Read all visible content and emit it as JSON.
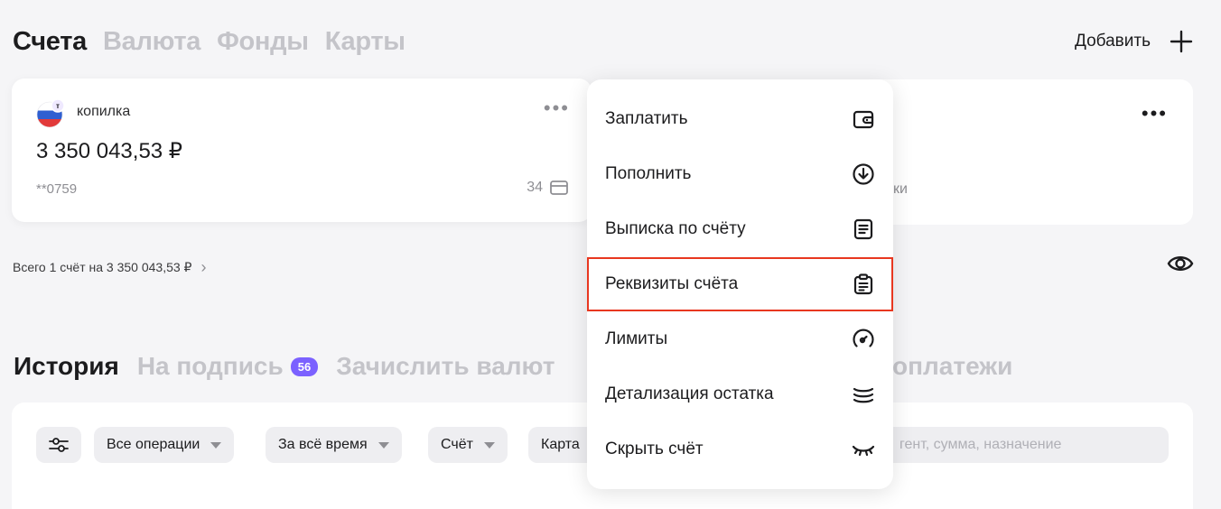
{
  "accounts_tabs": [
    "Счета",
    "Валюта",
    "Фонды",
    "Карты"
  ],
  "add_button": {
    "label": "Добавить",
    "icon": "plus-icon"
  },
  "card1": {
    "name": "копилка",
    "bank_badge": "т",
    "amount": "3 350 043,53 ₽",
    "number": "**0759",
    "cards_count": "34"
  },
  "card2": {
    "fragment": "ки"
  },
  "total": {
    "text": "Всего 1 счёт на 3 350 043,53 ₽"
  },
  "history_tabs": {
    "history": "История",
    "to_sign": "На подпись",
    "to_sign_badge": "56",
    "credit_currency": "Зачислить валют",
    "payments_fragment": "оплатежи"
  },
  "filters": {
    "all_ops": "Все операции",
    "period": "За всё время",
    "account": "Счёт",
    "card": "Карта",
    "search_placeholder": "гент, сумма, назначение"
  },
  "context_menu": {
    "items": [
      {
        "label": "Заплатить",
        "icon": "wallet-icon"
      },
      {
        "label": "Пополнить",
        "icon": "download-circle-icon"
      },
      {
        "label": "Выписка по счёту",
        "icon": "statement-icon"
      },
      {
        "label": "Реквизиты счёта",
        "icon": "clipboard-icon"
      },
      {
        "label": "Лимиты",
        "icon": "gauge-icon"
      },
      {
        "label": "Детализация остатка",
        "icon": "stack-icon"
      },
      {
        "label": "Скрыть счёт",
        "icon": "eye-closed-icon"
      }
    ],
    "highlight_color": "#e8371f"
  },
  "colors": {
    "accent_badge": "#7b61ff",
    "inactive_tab": "#c4c4c9"
  }
}
